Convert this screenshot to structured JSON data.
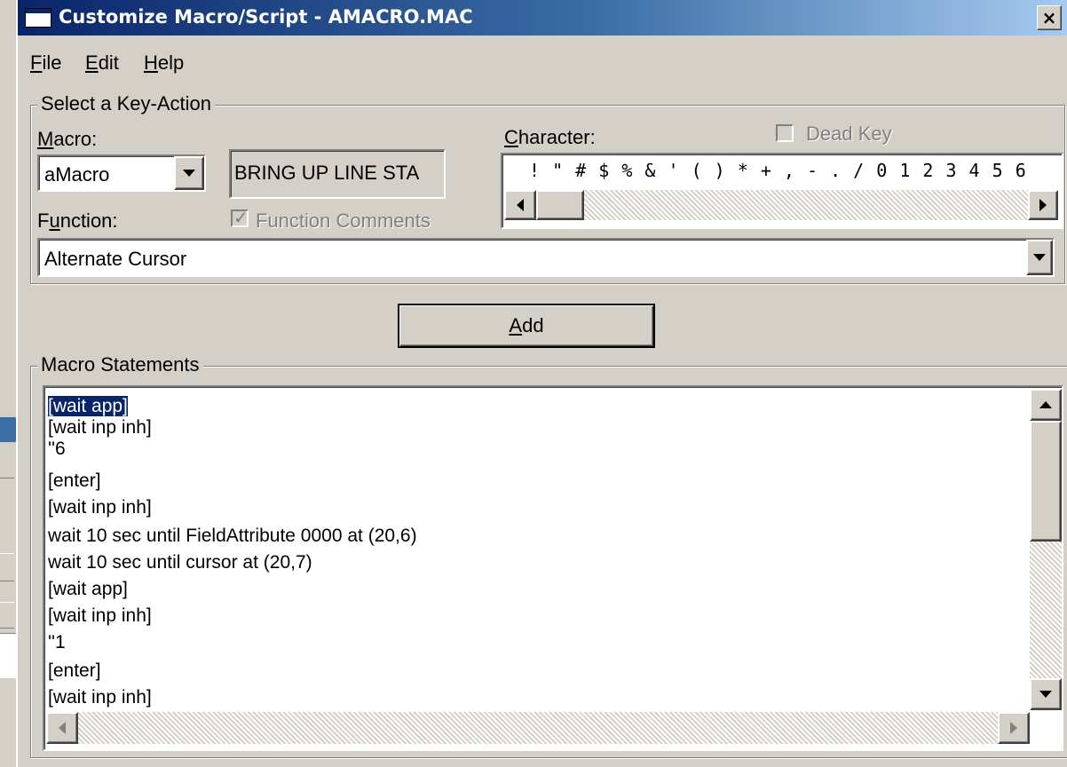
{
  "window": {
    "title": "Customize Macro/Script - AMACRO.MAC",
    "close_label": "×"
  },
  "menu": {
    "file": {
      "mnemonic": "F",
      "rest": "ile"
    },
    "edit": {
      "mnemonic": "E",
      "rest": "dit"
    },
    "help": {
      "mnemonic": "H",
      "rest": "elp"
    }
  },
  "key_action": {
    "group_label": "Select a Key-Action",
    "macro_label": {
      "mnemonic": "M",
      "rest": "acro:"
    },
    "macro_value": "aMacro",
    "comment_box": "BRING UP LINE STA",
    "function_label": {
      "pre": "F",
      "mnemonic": "u",
      "rest": "nction:"
    },
    "function_comments_label": "Function Comments",
    "function_comments_checked": true,
    "function_value": "Alternate Cursor",
    "character_label": {
      "mnemonic": "C",
      "rest": "haracter:"
    },
    "character_strip": "! \" # $ % & ' ( ) * + , - . / 0 1 2 3 4 5 6",
    "dead_key_label": "Dead Key",
    "dead_key_checked": false
  },
  "add_button": {
    "mnemonic": "A",
    "rest": "dd"
  },
  "statements": {
    "group_label": "Macro Statements",
    "lines": [
      "[wait app]",
      "[wait inp inh]",
      "''6",
      "[enter]",
      "[wait inp inh]",
      "wait 10 sec until FieldAttribute 0000 at (20,6)",
      "wait 10 sec until cursor at (20,7)",
      "[wait app]",
      "[wait inp inh]",
      "''1",
      "[enter]",
      "[wait inp inh]"
    ],
    "selected_index": 0
  },
  "icons": {
    "dropdown": "chevron-down-icon",
    "scroll_up": "arrow-up-icon",
    "scroll_down": "arrow-down-icon",
    "scroll_left": "arrow-left-icon",
    "scroll_right": "arrow-right-icon"
  },
  "colors": {
    "title_gradient_start": "#0a246a",
    "title_gradient_end": "#a6caf0",
    "face": "#d4d0c8",
    "selection": "#0a246a"
  }
}
